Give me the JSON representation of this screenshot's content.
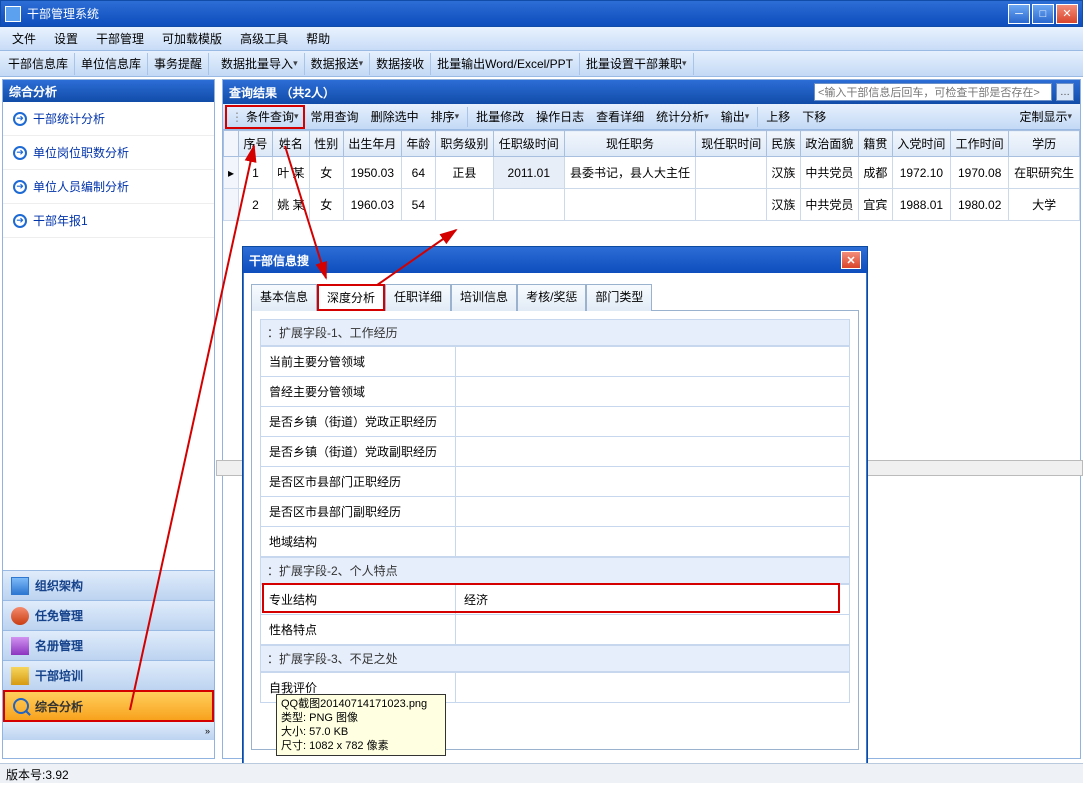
{
  "window": {
    "title": "干部管理系统"
  },
  "menubar": [
    "文件",
    "设置",
    "干部管理",
    "可加载模版",
    "高级工具",
    "帮助"
  ],
  "toolbar1": {
    "items": [
      "干部信息库",
      "单位信息库",
      "事务提醒"
    ],
    "items2": [
      "数据批量导入",
      "数据报送",
      "数据接收",
      "批量输出Word/Excel/PPT",
      "批量设置干部兼职"
    ],
    "drops": [
      true,
      true,
      false,
      false,
      true
    ]
  },
  "leftpanel": {
    "header": "综合分析",
    "links": [
      "干部统计分析",
      "单位岗位职数分析",
      "单位人员编制分析",
      "干部年报1"
    ],
    "nav": [
      "组织架构",
      "任免管理",
      "名册管理",
      "干部培训",
      "综合分析"
    ]
  },
  "result": {
    "title": "查询结果 （共2人）",
    "search_placeholder": "<输入干部信息后回车，可检查干部是否存在>"
  },
  "querybar": {
    "first": "条件查询",
    "items": [
      "常用查询",
      "删除选中",
      "排序",
      "批量修改",
      "操作日志",
      "查看详细",
      "统计分析",
      "输出",
      "上移",
      "下移"
    ],
    "right": "定制显示"
  },
  "grid": {
    "headers": [
      "序号",
      "姓名",
      "性别",
      "出生年月",
      "年龄",
      "职务级别",
      "任职级时间",
      "现任职务",
      "现任职时间",
      "民族",
      "政治面貌",
      "籍贯",
      "入党时间",
      "工作时间",
      "学历"
    ],
    "rows": [
      {
        "selmark": "▸",
        "cells": [
          "1",
          "叶  某",
          "女",
          "1950.03",
          "64",
          "正县",
          "2011.01",
          "县委书记，县人大主任",
          "",
          "汉族",
          "中共党员",
          "成都",
          "1972.10",
          "1970.08",
          "在职研究生"
        ]
      },
      {
        "selmark": "",
        "cells": [
          "2",
          "姚  某",
          "女",
          "1960.03",
          "54",
          "",
          "",
          "",
          "",
          "汉族",
          "中共党员",
          "宜宾",
          "1988.01",
          "1980.02",
          "大学"
        ]
      }
    ]
  },
  "dialog": {
    "title": "干部信息搜",
    "tabs": [
      "基本信息",
      "深度分析",
      "任职详细",
      "培训信息",
      "考核/奖惩",
      "部门类型"
    ],
    "active_tab": 1,
    "sections": [
      {
        "head": "：扩展字段-1、工作经历",
        "rows": [
          [
            "当前主要分管领域",
            ""
          ],
          [
            "曾经主要分管领域",
            ""
          ],
          [
            "是否乡镇（街道）党政正职经历",
            ""
          ],
          [
            "是否乡镇（街道）党政副职经历",
            ""
          ],
          [
            "是否区市县部门正职经历",
            ""
          ],
          [
            "是否区市县部门副职经历",
            ""
          ],
          [
            "地域结构",
            ""
          ]
        ]
      },
      {
        "head": "：扩展字段-2、个人特点",
        "rows": [
          [
            "专业结构",
            "经济"
          ],
          [
            "性格特点",
            ""
          ]
        ]
      },
      {
        "head": "：扩展字段-3、不足之处",
        "rows": [
          [
            "自我评价",
            ""
          ]
        ]
      }
    ]
  },
  "tooltip": {
    "l1": "QQ截图20140714171023.png",
    "l2": "类型: PNG 图像",
    "l3": "大小: 57.0 KB",
    "l4": "尺寸: 1082 x 782 像素"
  },
  "status": "版本号:3.92"
}
